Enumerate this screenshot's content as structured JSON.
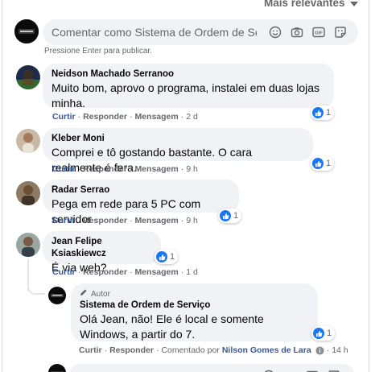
{
  "sort_label": "Mais relevantes",
  "composer": {
    "placeholder": "Comentar como Sistema de Ordem de Serviço",
    "hint": "Pressione Enter para publicar."
  },
  "comments": [
    {
      "author": "Neidson Machado Serranoo",
      "text": "Muito bom, aprovo o programa, instalei em duas lojas minha.",
      "time": "2 d",
      "likes": "1"
    },
    {
      "author": "Kleber Moni",
      "text": "Comprei e tô gostando bastante. O cara realmente é fera.",
      "time": "9 h",
      "likes": "1"
    },
    {
      "author": "Radar Serrao",
      "text": "Pega em rede para 5 PC com servidor",
      "time": "9 h",
      "likes": "1"
    },
    {
      "author": "Jean Felipe Ksiaskiewcz",
      "text": "É via web?",
      "time": "1 d",
      "likes": "1"
    }
  ],
  "reply": {
    "tag": "Autor",
    "author": "Sistema de Ordem de Serviço",
    "text": "Olá Jean, não! Ele é local e somente Windows, a partir do 7.",
    "likes": "1",
    "commented_by_prefix": "Comentado por",
    "commented_by": "Nilson Gomes de Lara",
    "time": "14 h"
  },
  "actions": {
    "like": "Curtir",
    "reply": "Responder",
    "message": "Mensagem",
    "separator": "·"
  },
  "colors": {
    "bubble": "#f0f2f5",
    "action_blue": "#385898",
    "like_blue": "#1877f2",
    "muted": "#65676b"
  },
  "icons": [
    "caret-down-icon",
    "emoji-icon",
    "camera-icon",
    "gif-icon",
    "sticker-icon",
    "like-icon",
    "pencil-icon",
    "info-icon"
  ]
}
